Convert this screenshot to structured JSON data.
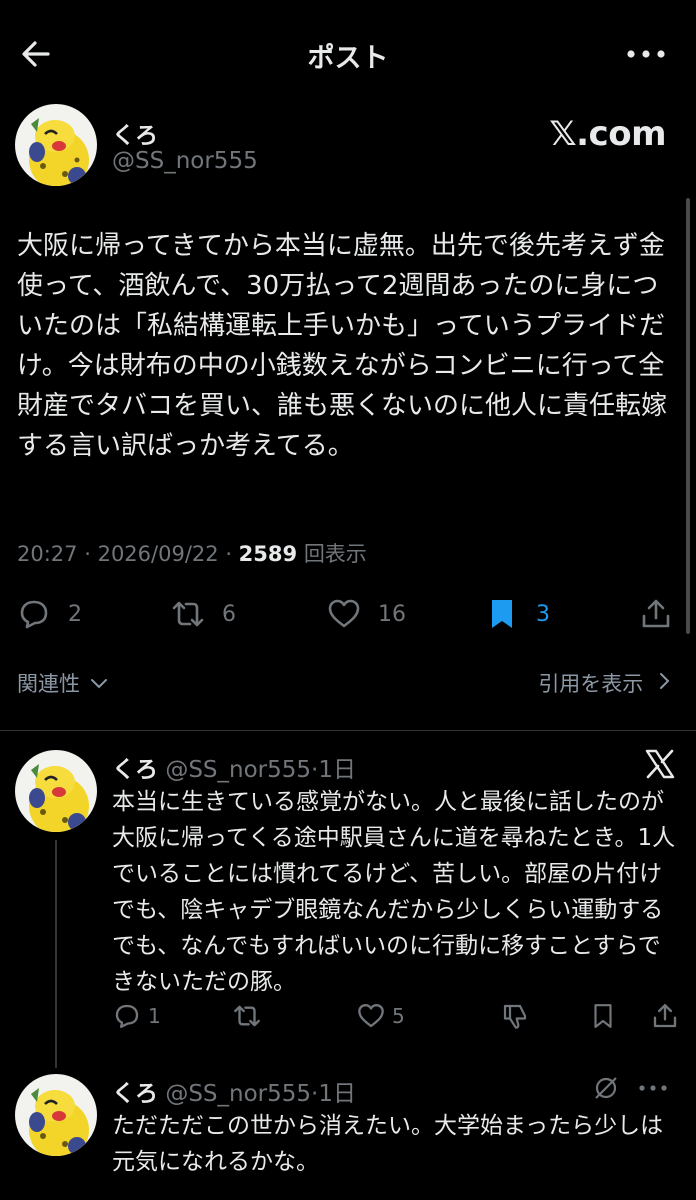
{
  "header": {
    "title": "ポスト"
  },
  "post": {
    "name": "くろ",
    "handle": "@SS_nor555",
    "brand": "𝕏.com",
    "text": "大阪に帰ってきてから本当に虚無。出先で後先考えず金使って、酒飲んで、30万払って2週間あったのに身についたのは「私結構運転上手いかも」っていうプライドだけ。今は財布の中の小銭数えながらコンビニに行って全財産でタバコを買い、誰も悪くないのに他人に責任転嫁する言い訳ばっか考えてる。",
    "time": "20:27",
    "date": "2026/09/22",
    "views": "2589",
    "views_label": "回表示",
    "replies": "2",
    "reposts": "6",
    "likes": "16",
    "bookmarks": "3"
  },
  "related": {
    "label": "関連性",
    "quotes_label": "引用を表示"
  },
  "replies": [
    {
      "name": "くろ",
      "handle": "@SS_nor555",
      "time": "1日",
      "text": "本当に生きている感覚がない。人と最後に話したのが大阪に帰ってくる途中駅員さんに道を尋ねたとき。1人でいることには慣れてるけど、苦しい。部屋の片付けでも、陰キャデブ眼鏡なんだから少しくらい運動するでも、なんでもすればいいのに行動に移すことすらできないただの豚。",
      "reply_count": "1",
      "like_count": "5"
    },
    {
      "name": "くろ",
      "handle": "@SS_nor555",
      "time": "1日",
      "text": "ただただこの世から消えたい。大学始まったら少しは元気になれるかな。"
    }
  ],
  "colors": {
    "accent": "#1d9bf0",
    "muted": "#71767b",
    "text": "#e7e9ea",
    "bg": "#000000"
  }
}
